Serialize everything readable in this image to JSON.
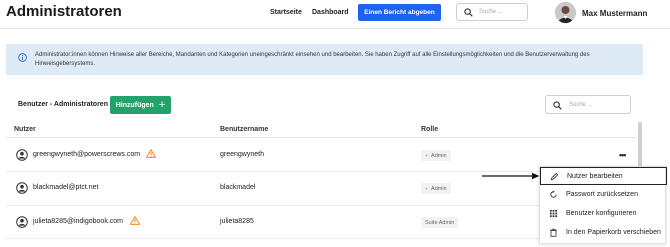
{
  "header": {
    "title": "Administratoren",
    "nav": [
      "Startseite",
      "Dashboard"
    ],
    "report_button": "Einen Bericht abgeben",
    "search_placeholder": "Suche ...",
    "user_name": "Max Mustermann"
  },
  "info_banner": {
    "text": "Administrator:innen können Hinweise aller Bereiche, Mandanten und Kategorien uneingeschränkt einsehen und bearbeiten. Sie haben Zugriff auf alle Einstellungsmöglichkeiten und die Benutzerverwaltung des Hinweisgebersystems."
  },
  "section": {
    "title": "Benutzer - Administratoren",
    "add_button": "Hinzufügen",
    "search_placeholder": "Suche ..."
  },
  "table": {
    "columns": [
      "Nutzer",
      "Benutzername",
      "Rolle"
    ],
    "rows": [
      {
        "email": "greengwyneth@powerscrews.com",
        "username": "greengwyneth",
        "role": "Admin",
        "warning": true
      },
      {
        "email": "blackmadel@ptct.net",
        "username": "blackmadel",
        "role": "Admin",
        "warning": false
      },
      {
        "email": "julieta8285@indigobook.com",
        "username": "julieta8285",
        "role": "Suite Admin",
        "warning": true
      }
    ]
  },
  "context_menu": {
    "items": [
      {
        "label": "Nutzer bearbeiten",
        "icon": "pencil-icon",
        "active": true
      },
      {
        "label": "Passwort zurücksetzen",
        "icon": "reset-icon",
        "active": false
      },
      {
        "label": "Benutzer konfigurieren",
        "icon": "grid-icon",
        "active": false
      },
      {
        "label": "In den Papierkorb verschieben",
        "icon": "trash-icon",
        "active": false
      }
    ]
  },
  "colors": {
    "primary": "#1e63f0",
    "success": "#22a36b",
    "info_bg": "#dfeaf7",
    "warning": "#f08a24"
  }
}
